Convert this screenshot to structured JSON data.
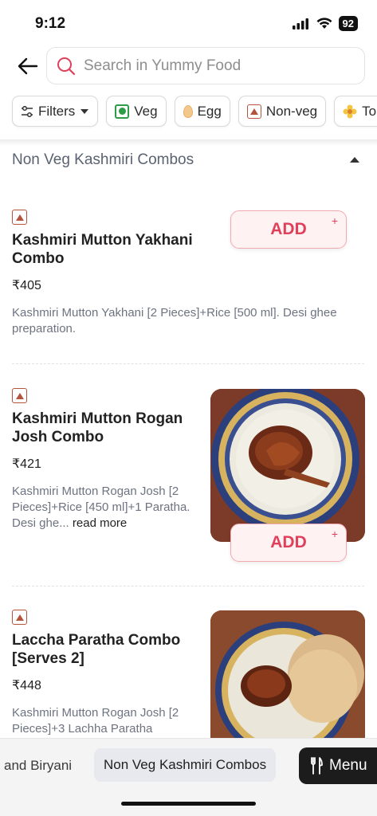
{
  "status_bar": {
    "time": "9:12",
    "battery": "92"
  },
  "search": {
    "placeholder": "Search in Yummy Food"
  },
  "filters": [
    {
      "label": "Filters",
      "icon": "sliders-icon"
    },
    {
      "label": "Veg",
      "icon": "veg-mark-icon"
    },
    {
      "label": "Egg",
      "icon": "egg-icon"
    },
    {
      "label": "Non-veg",
      "icon": "nonveg-mark-icon"
    },
    {
      "label": "To",
      "icon": "flower-icon"
    }
  ],
  "section": {
    "title": "Non Veg Kashmiri Combos"
  },
  "items": [
    {
      "name": "Kashmiri Mutton Yakhani Combo",
      "price": "₹405",
      "description": "Kashmiri Mutton Yakhani [2 Pieces]+Rice [500 ml]. Desi ghee preparation.",
      "add_label": "ADD"
    },
    {
      "name": "Kashmiri Mutton Rogan Josh Combo",
      "price": "₹421",
      "description": "Kashmiri Mutton Rogan Josh [2 Pieces]+Rice [450 ml]+1 Paratha. Desi ghe...",
      "read_more": "read more",
      "add_label": "ADD"
    },
    {
      "name": "Laccha Paratha Combo [Serves 2]",
      "price": "₹448",
      "description": "Kashmiri Mutton Rogan Josh [2 Pieces]+3 Lachha Paratha"
    }
  ],
  "bottom_bar": {
    "prev_category": "and Biryani",
    "active_category": "Non Veg Kashmiri Combos",
    "menu_label": "Menu"
  },
  "colors": {
    "accent": "#e0405a",
    "veg": "#2f9c48",
    "nonveg": "#b3543d"
  }
}
